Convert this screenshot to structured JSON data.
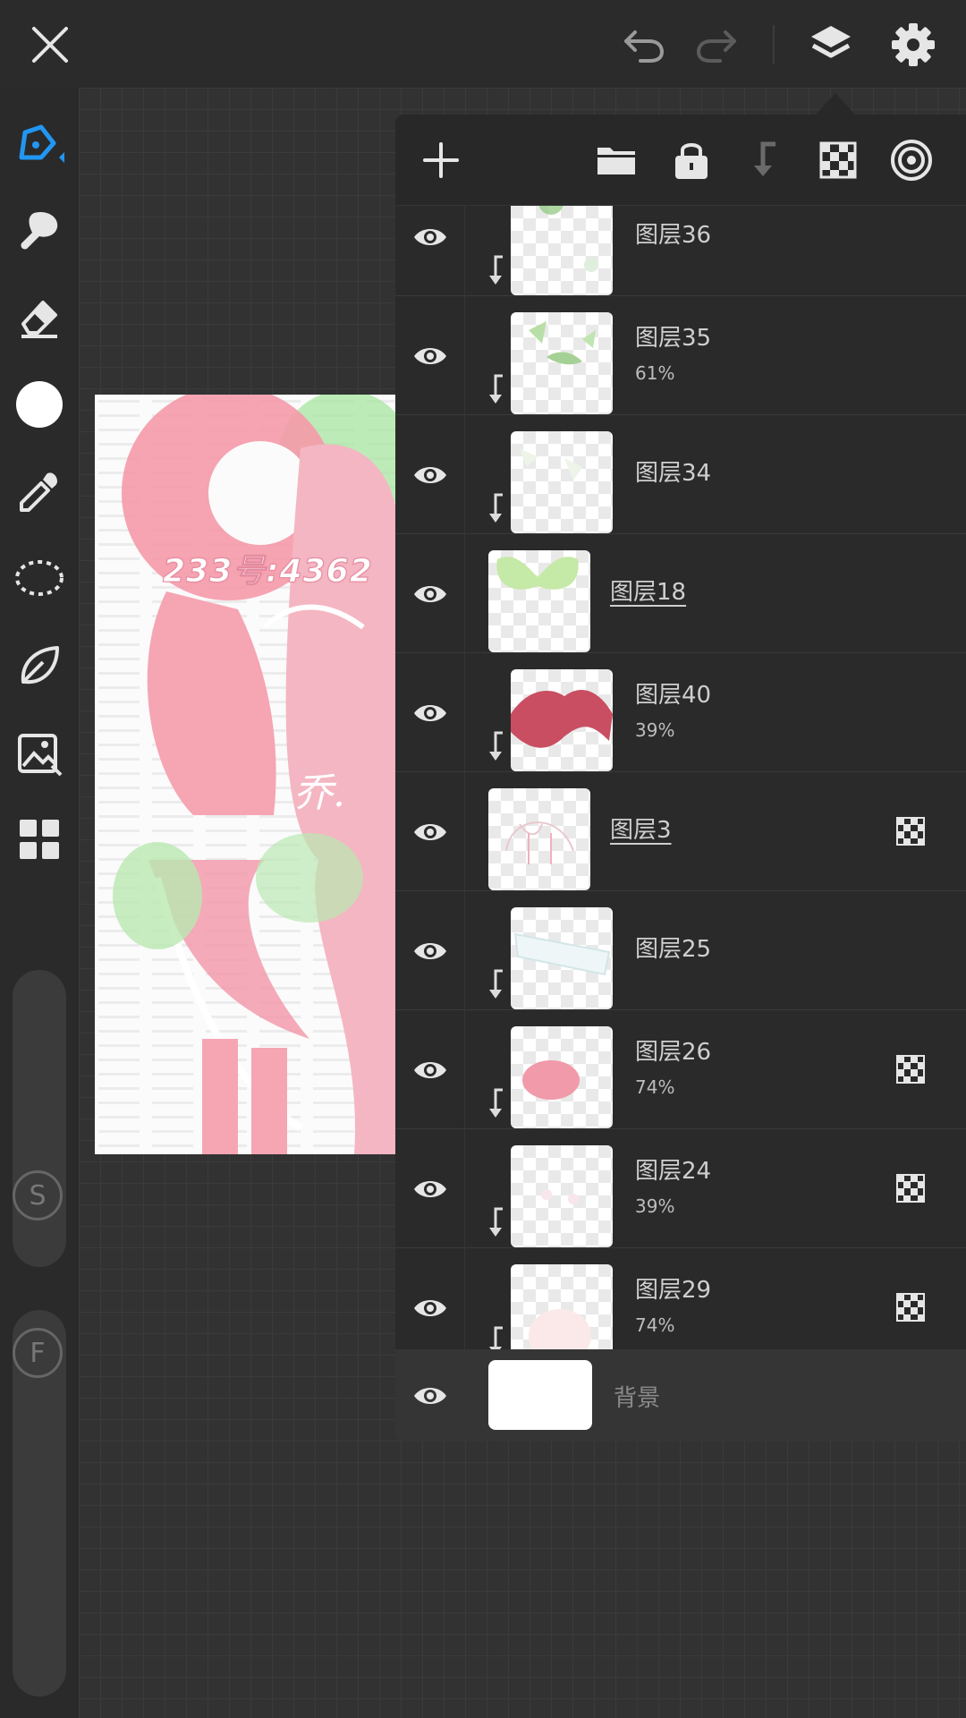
{
  "topbar": {
    "close_icon": "close-icon",
    "undo_icon": "undo-icon",
    "redo_icon": "redo-icon",
    "layers_icon": "layers-icon",
    "settings_icon": "gear-icon"
  },
  "toolbar": {
    "tools": [
      "pen-icon",
      "smudge-icon",
      "eraser-icon",
      "color-icon",
      "eyedropper-icon",
      "lasso-icon",
      "leaf-icon",
      "image-import-icon",
      "grid-menu-icon"
    ],
    "size_slider_label": "S",
    "flow_slider_label": "F"
  },
  "canvas": {
    "watermark_text": "233号:4362",
    "brush_stroke_text": "乔."
  },
  "layers_panel": {
    "actions": [
      "add-layer-icon",
      "folder-icon",
      "lock-icon",
      "clip-icon",
      "transparency-icon",
      "target-icon"
    ],
    "layers": [
      {
        "name": "图层36",
        "opacity": "",
        "clipped": true,
        "blend_mode_icon": false
      },
      {
        "name": "图层35",
        "opacity": "61%",
        "clipped": true,
        "blend_mode_icon": false
      },
      {
        "name": "图层34",
        "opacity": "",
        "clipped": true,
        "blend_mode_icon": false
      },
      {
        "name": "图层18",
        "opacity": "",
        "clipped": false,
        "blend_mode_icon": false,
        "selected": true
      },
      {
        "name": "图层40",
        "opacity": "39%",
        "clipped": true,
        "blend_mode_icon": false
      },
      {
        "name": "图层3",
        "opacity": "",
        "clipped": false,
        "blend_mode_icon": true,
        "selected": true
      },
      {
        "name": "图层25",
        "opacity": "",
        "clipped": true,
        "blend_mode_icon": false
      },
      {
        "name": "图层26",
        "opacity": "74%",
        "clipped": true,
        "blend_mode_icon": true
      },
      {
        "name": "图层24",
        "opacity": "39%",
        "clipped": true,
        "blend_mode_icon": true
      },
      {
        "name": "图层29",
        "opacity": "74%",
        "clipped": true,
        "blend_mode_icon": true
      }
    ],
    "background_layer": {
      "name": "背景"
    }
  },
  "colors": {
    "accent": "#2196f3",
    "panel_bg": "#2a2a2a",
    "text": "#cfcfcf"
  }
}
